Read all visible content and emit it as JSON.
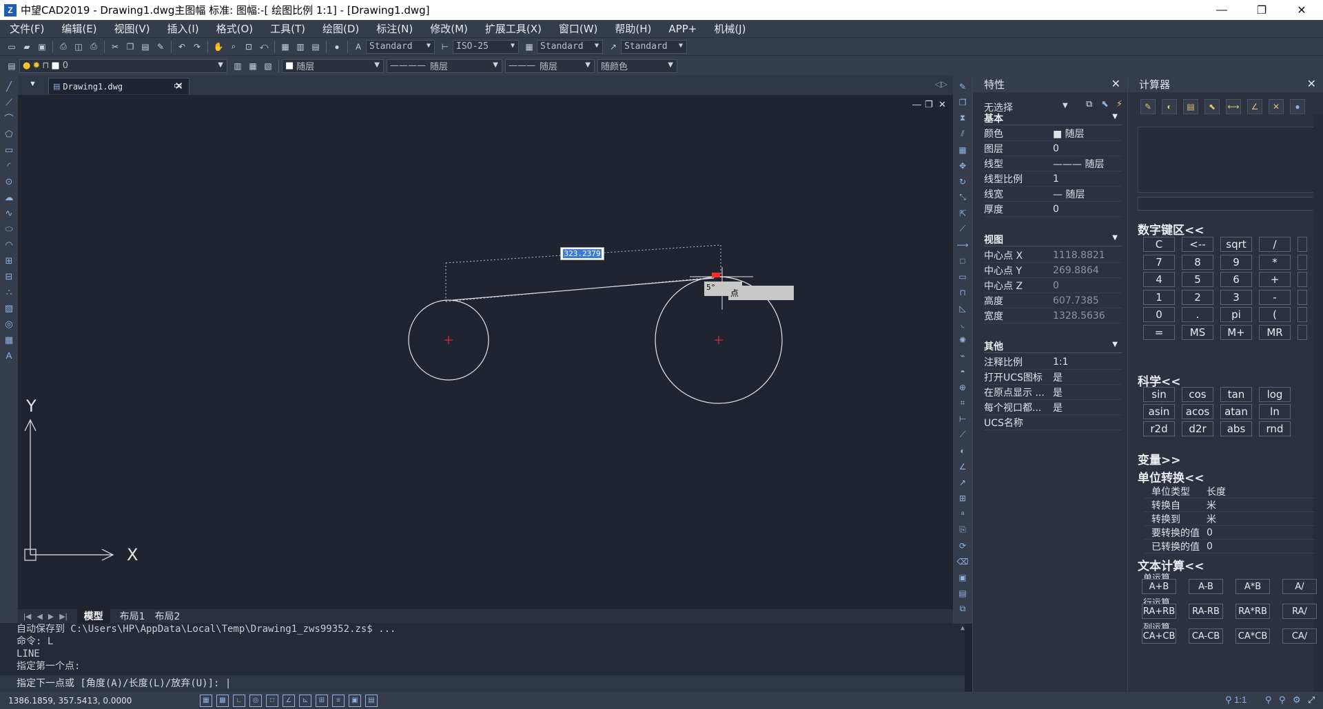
{
  "titlebar": {
    "title": "中望CAD2019 - Drawing1.dwg主图幅  标准: 图幅:-[ 绘图比例 1:1] - [Drawing1.dwg]",
    "minimize": "—",
    "restore": "❐",
    "close": "✕"
  },
  "menu": [
    "文件(F)",
    "编辑(E)",
    "视图(V)",
    "插入(I)",
    "格式(O)",
    "工具(T)",
    "绘图(D)",
    "标注(N)",
    "修改(M)",
    "扩展工具(X)",
    "窗口(W)",
    "帮助(H)",
    "APP+",
    "机械(J)"
  ],
  "toolbar1": {
    "text_style": "Standard",
    "dim_style": "ISO-25",
    "table_style": "Standard",
    "multileader_style": "Standard"
  },
  "toolbar2": {
    "layer": "0",
    "color": "随层",
    "linetype": "随层",
    "lineweight": "随层",
    "plotstyle": "随颜色"
  },
  "document": {
    "tab_name": "Drawing1.dwg",
    "tab_close": "✕"
  },
  "canvas": {
    "dim_value": "323.2379",
    "angle_tip": "5°",
    "snap_tip": "点",
    "ucs_y": "Y",
    "ucs_x": "X",
    "vp_min": "—",
    "vp_restore": "❐",
    "vp_close": "✕"
  },
  "layout_tabs": [
    "模型",
    "布局1",
    "布局2"
  ],
  "command": {
    "history": [
      "自动保存到 C:\\Users\\HP\\AppData\\Local\\Temp\\Drawing1_zws99352.zs$ ...",
      "命令: L",
      "LINE",
      "指定第一个点:"
    ],
    "prompt": "指定下一点或 [角度(A)/长度(L)/放弃(U)]: |"
  },
  "status": {
    "coords": "1386.1859, 357.5413, 0.0000"
  },
  "properties": {
    "title": "特性",
    "selection": "无选择",
    "sections": {
      "basic": "基本",
      "view": "视图",
      "other": "其他"
    },
    "basic_rows": [
      {
        "k": "颜色",
        "v": "■ 随层"
      },
      {
        "k": "图层",
        "v": "0"
      },
      {
        "k": "线型",
        "v": "——— 随层"
      },
      {
        "k": "线型比例",
        "v": "1"
      },
      {
        "k": "线宽",
        "v": "— 随层"
      },
      {
        "k": "厚度",
        "v": "0"
      }
    ],
    "view_rows": [
      {
        "k": "中心点 X",
        "v": "1118.8821"
      },
      {
        "k": "中心点 Y",
        "v": "269.8864"
      },
      {
        "k": "中心点 Z",
        "v": "0"
      },
      {
        "k": "高度",
        "v": "607.7385"
      },
      {
        "k": "宽度",
        "v": "1328.5636"
      }
    ],
    "other_rows": [
      {
        "k": "注释比例",
        "v": "1:1"
      },
      {
        "k": "打开UCS图标",
        "v": "是"
      },
      {
        "k": "在原点显示 ...",
        "v": "是"
      },
      {
        "k": "每个视口都...",
        "v": "是"
      },
      {
        "k": "UCS名称",
        "v": ""
      }
    ]
  },
  "calculator": {
    "title": "计算器",
    "numpad_title": "数字键区<<",
    "numpad": [
      [
        "C",
        "<--",
        "sqrt",
        "/"
      ],
      [
        "7",
        "8",
        "9",
        "*"
      ],
      [
        "4",
        "5",
        "6",
        "+"
      ],
      [
        "1",
        "2",
        "3",
        "-"
      ],
      [
        "0",
        ".",
        "pi",
        "("
      ],
      [
        "=",
        "MS",
        "M+",
        "MR"
      ]
    ],
    "sci_title": "科学<<",
    "sci": [
      [
        "sin",
        "cos",
        "tan",
        "log"
      ],
      [
        "asin",
        "acos",
        "atan",
        "ln"
      ],
      [
        "r2d",
        "d2r",
        "abs",
        "rnd"
      ]
    ],
    "var_title": "变量>>",
    "unit_title": "单位转换<<",
    "unit_rows": [
      {
        "k": "单位类型",
        "v": "长度"
      },
      {
        "k": "转换自",
        "v": "米"
      },
      {
        "k": "转换到",
        "v": "米"
      },
      {
        "k": "要转换的值",
        "v": "0"
      },
      {
        "k": "已转换的值",
        "v": "0"
      }
    ],
    "text_title": "文本计算<<",
    "single_label": "单运算",
    "single": [
      "A+B",
      "A-B",
      "A*B",
      "A/"
    ],
    "row_label": "行运算",
    "row": [
      "RA+RB",
      "RA-RB",
      "RA*RB",
      "RA/"
    ],
    "col_label": "列运算",
    "col": [
      "CA+CB",
      "CA-CB",
      "CA*CB",
      "CA/"
    ]
  }
}
